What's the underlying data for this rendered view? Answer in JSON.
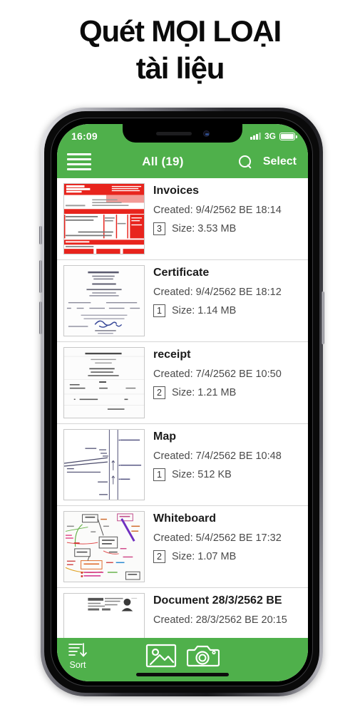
{
  "headline": "Quét MỌI LOẠI\ntài liệu",
  "theme": {
    "green": "#4fb04b",
    "text_dark": "#1b1b1b",
    "text_muted": "#4a4a4a"
  },
  "phone": {
    "status_bar": {
      "clock": "16:09",
      "network": "3G",
      "signal_icon": "signal-bars-icon",
      "battery_icon": "battery-full-icon"
    },
    "nav_bar": {
      "menu_icon": "hamburger-menu-icon",
      "title": "All (19)",
      "search_icon": "search-icon",
      "select_label": "Select"
    },
    "documents": [
      {
        "title": "Invoices",
        "created": "Created: 9/4/2562 BE 18:14",
        "pages": "3",
        "size": "Size: 3.53 MB",
        "thumb": "invoice-red-form"
      },
      {
        "title": "Certificate",
        "created": "Created: 9/4/2562 BE 18:12",
        "pages": "1",
        "size": "Size: 1.14 MB",
        "thumb": "certificate-document"
      },
      {
        "title": "receipt",
        "created": "Created: 7/4/2562 BE 10:50",
        "pages": "2",
        "size": "Size: 1.21 MB",
        "thumb": "receipt-slip"
      },
      {
        "title": "Map",
        "created": "Created: 7/4/2562 BE 10:48",
        "pages": "1",
        "size": "Size: 512 KB",
        "thumb": "hand-drawn-map"
      },
      {
        "title": "Whiteboard",
        "created": "Created: 5/4/2562 BE 17:32",
        "pages": "2",
        "size": "Size: 1.07 MB",
        "thumb": "whiteboard-mindmap"
      },
      {
        "title": "Document 28/3/2562 BE",
        "created": "Created: 28/3/2562 BE 20:15",
        "pages": "",
        "size": "",
        "thumb": "id-card-document"
      }
    ],
    "toolbar": {
      "sort_label": "Sort",
      "sort_icon": "sort-descending-icon",
      "gallery_icon": "image-picture-icon",
      "camera_icon": "camera-icon"
    }
  }
}
